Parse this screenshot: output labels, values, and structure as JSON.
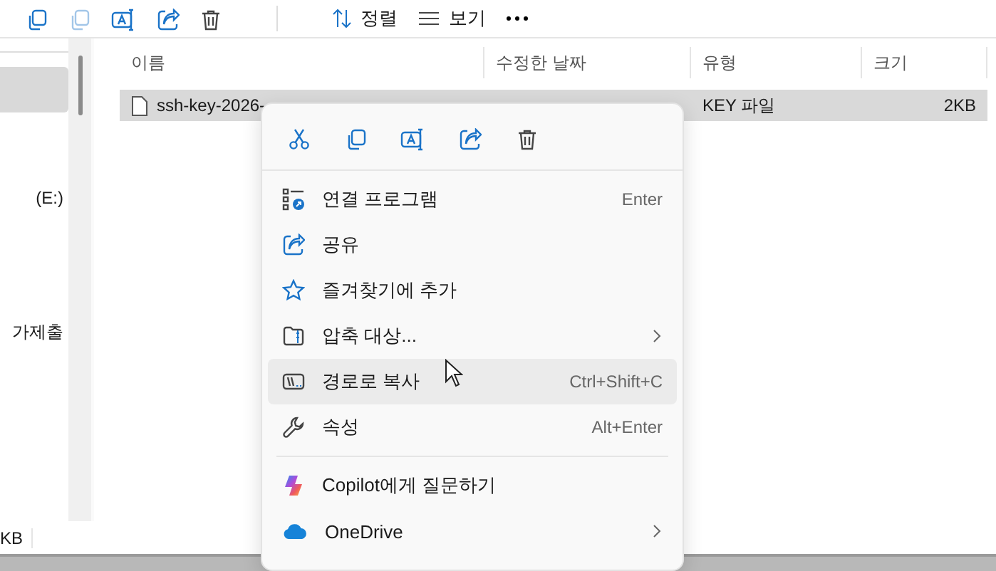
{
  "toolbar": {
    "sort_label": "정렬",
    "view_label": "보기"
  },
  "sidebar": {
    "items": [
      {
        "selected": true
      },
      {
        "label": "(E:)",
        "selected": false
      },
      {
        "label": "가제출",
        "selected": false
      }
    ]
  },
  "table": {
    "columns": [
      "이름",
      "수정한 날짜",
      "유형",
      "크기"
    ],
    "rows": [
      {
        "name": "ssh-key-2026-",
        "type": "KEY 파일",
        "size": "2KB",
        "selected": true
      }
    ]
  },
  "status_bar": {
    "text": "KB"
  },
  "context_menu": {
    "groups": [
      [
        {
          "kind": "open_with",
          "label": "연결 프로그램",
          "shortcut": "Enter",
          "submenu": false,
          "selected": false
        },
        {
          "kind": "share",
          "label": "공유",
          "submenu": false,
          "selected": false
        },
        {
          "kind": "star",
          "label": "즐겨찾기에 추가",
          "submenu": false,
          "selected": false
        },
        {
          "kind": "zip",
          "label": "압축 대상...",
          "submenu": true,
          "selected": false
        },
        {
          "kind": "path",
          "label": "경로로 복사",
          "shortcut": "Ctrl+Shift+C",
          "submenu": false,
          "selected": true
        },
        {
          "kind": "wrench",
          "label": "속성",
          "shortcut": "Alt+Enter",
          "submenu": false,
          "selected": false
        }
      ],
      [
        {
          "kind": "copilot",
          "label": "Copilot에게 질문하기",
          "submenu": false,
          "selected": false
        },
        {
          "kind": "cloud",
          "label": "OneDrive",
          "submenu": true,
          "selected": false
        }
      ]
    ]
  }
}
